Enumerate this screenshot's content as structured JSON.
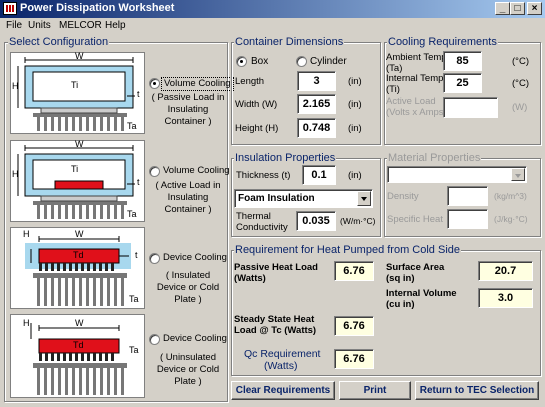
{
  "window": {
    "title": "Power Dissipation Worksheet"
  },
  "menu": [
    "File",
    "Units",
    "MELCOR",
    "Help"
  ],
  "select_config": {
    "title": "Select Configuration",
    "options": [
      {
        "label": "Volume Cooling",
        "desc": [
          "( Passive Load in",
          "Insulating",
          "Container )"
        ],
        "selected": true
      },
      {
        "label": "Volume Cooling",
        "desc": [
          "( Active Load in",
          "Insulating",
          "Container )"
        ],
        "selected": false
      },
      {
        "label": "Device Cooling",
        "desc": [
          "( Insulated",
          "Device or Cold",
          "Plate )"
        ],
        "selected": false
      },
      {
        "label": "Device Cooling",
        "desc": [
          "( Uninsulated",
          "Device or Cold",
          "Plate )"
        ],
        "selected": false
      }
    ],
    "diagram_labels": {
      "w": "W",
      "h": "H",
      "ti": "Ti",
      "ta": "Ta",
      "t": "t",
      "td": "Td"
    }
  },
  "container": {
    "title": "Container Dimensions",
    "shape_box": "Box",
    "shape_cylinder": "Cylinder",
    "length_label": "Length",
    "length_value": "3",
    "length_unit": "(in)",
    "width_label": "Width (W)",
    "width_value": "2.165",
    "width_unit": "(in)",
    "height_label": "Height (H)",
    "height_value": "0.748",
    "height_unit": "(in)"
  },
  "cooling": {
    "title": "Cooling Requirements",
    "ambient_label": "Ambient Temp",
    "ambient_sub": "(Ta)",
    "ambient_value": "85",
    "ambient_unit": "(°C)",
    "internal_label": "Internal Temp",
    "internal_sub": "(Ti)",
    "internal_value": "25",
    "internal_unit": "(°C)",
    "active_label": "Active Load",
    "active_sub": "(Volts x Amps)",
    "active_value": "",
    "active_unit": "(W)"
  },
  "insulation": {
    "title": "Insulation Properties",
    "thickness_label": "Thickness (t)",
    "thickness_value": "0.1",
    "thickness_unit": "(in)",
    "material": "Foam Insulation",
    "conductivity_label": "Thermal",
    "conductivity_label2": "Conductivity",
    "conductivity_value": "0.035",
    "conductivity_unit": "(W/m·°C)"
  },
  "material": {
    "title": "Material Properties",
    "density_label": "Density",
    "density_unit": "(kg/m^3)",
    "specific_heat_label": "Specific Heat",
    "specific_heat_unit": "(J/kg·°C)"
  },
  "heat": {
    "title": "Requirement for Heat Pumped from Cold Side",
    "passive_label": "Passive Heat Load",
    "passive_sub": "(Watts)",
    "passive_value": "6.76",
    "steady_label": "Steady State Heat",
    "steady_sub": "Load @ Tc (Watts)",
    "steady_value": "6.76",
    "surface_label": "Surface Area",
    "surface_sub": "(sq in)",
    "surface_value": "20.7",
    "internal_vol_label": "Internal Volume",
    "internal_vol_sub": "(cu in)",
    "internal_vol_value": "3.0",
    "qc_label": "Qc Requirement",
    "qc_sub": "(Watts)",
    "qc_value": "6.76"
  },
  "buttons": {
    "clear": "Clear Requirements",
    "print": "Print",
    "return": "Return to TEC Selection"
  },
  "colors": {
    "accent": "#0a246a",
    "highlight": "#ffffe1",
    "device": "#e0101a",
    "insulation": "#a8d8ee"
  }
}
